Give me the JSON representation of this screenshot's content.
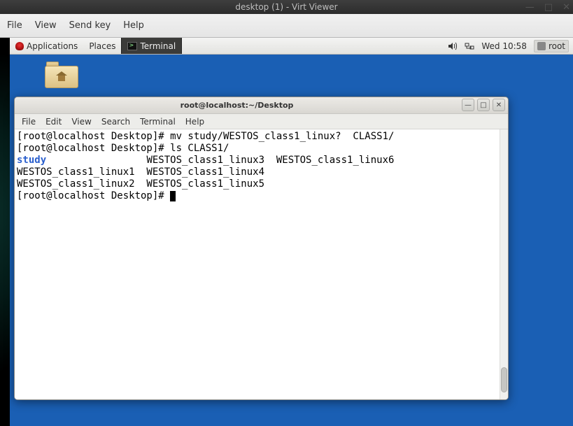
{
  "virt_viewer": {
    "title": "desktop (1) - Virt Viewer",
    "menu": {
      "file": "File",
      "view": "View",
      "send_key": "Send key",
      "help": "Help"
    },
    "controls": {
      "min": "—",
      "max": "□",
      "close": "✕"
    }
  },
  "panel": {
    "applications": "Applications",
    "places": "Places",
    "task_terminal": "Terminal",
    "clock": "Wed 10:58",
    "user": "root"
  },
  "terminal_window": {
    "title": "root@localhost:~/Desktop",
    "menu": {
      "file": "File",
      "edit": "Edit",
      "view": "View",
      "search": "Search",
      "terminal": "Terminal",
      "help": "Help"
    },
    "controls": {
      "min": "—",
      "max": "□",
      "close": "✕"
    }
  },
  "terminal_output": {
    "line1": "[root@localhost Desktop]# mv study/WESTOS_class1_linux?  CLASS1/",
    "line2": "[root@localhost Desktop]# ls CLASS1/",
    "line3_dir": "study",
    "line3_rest": "                 WESTOS_class1_linux3  WESTOS_class1_linux6",
    "line4": "WESTOS_class1_linux1  WESTOS_class1_linux4",
    "line5": "WESTOS_class1_linux2  WESTOS_class1_linux5",
    "line6": "[root@localhost Desktop]# "
  }
}
